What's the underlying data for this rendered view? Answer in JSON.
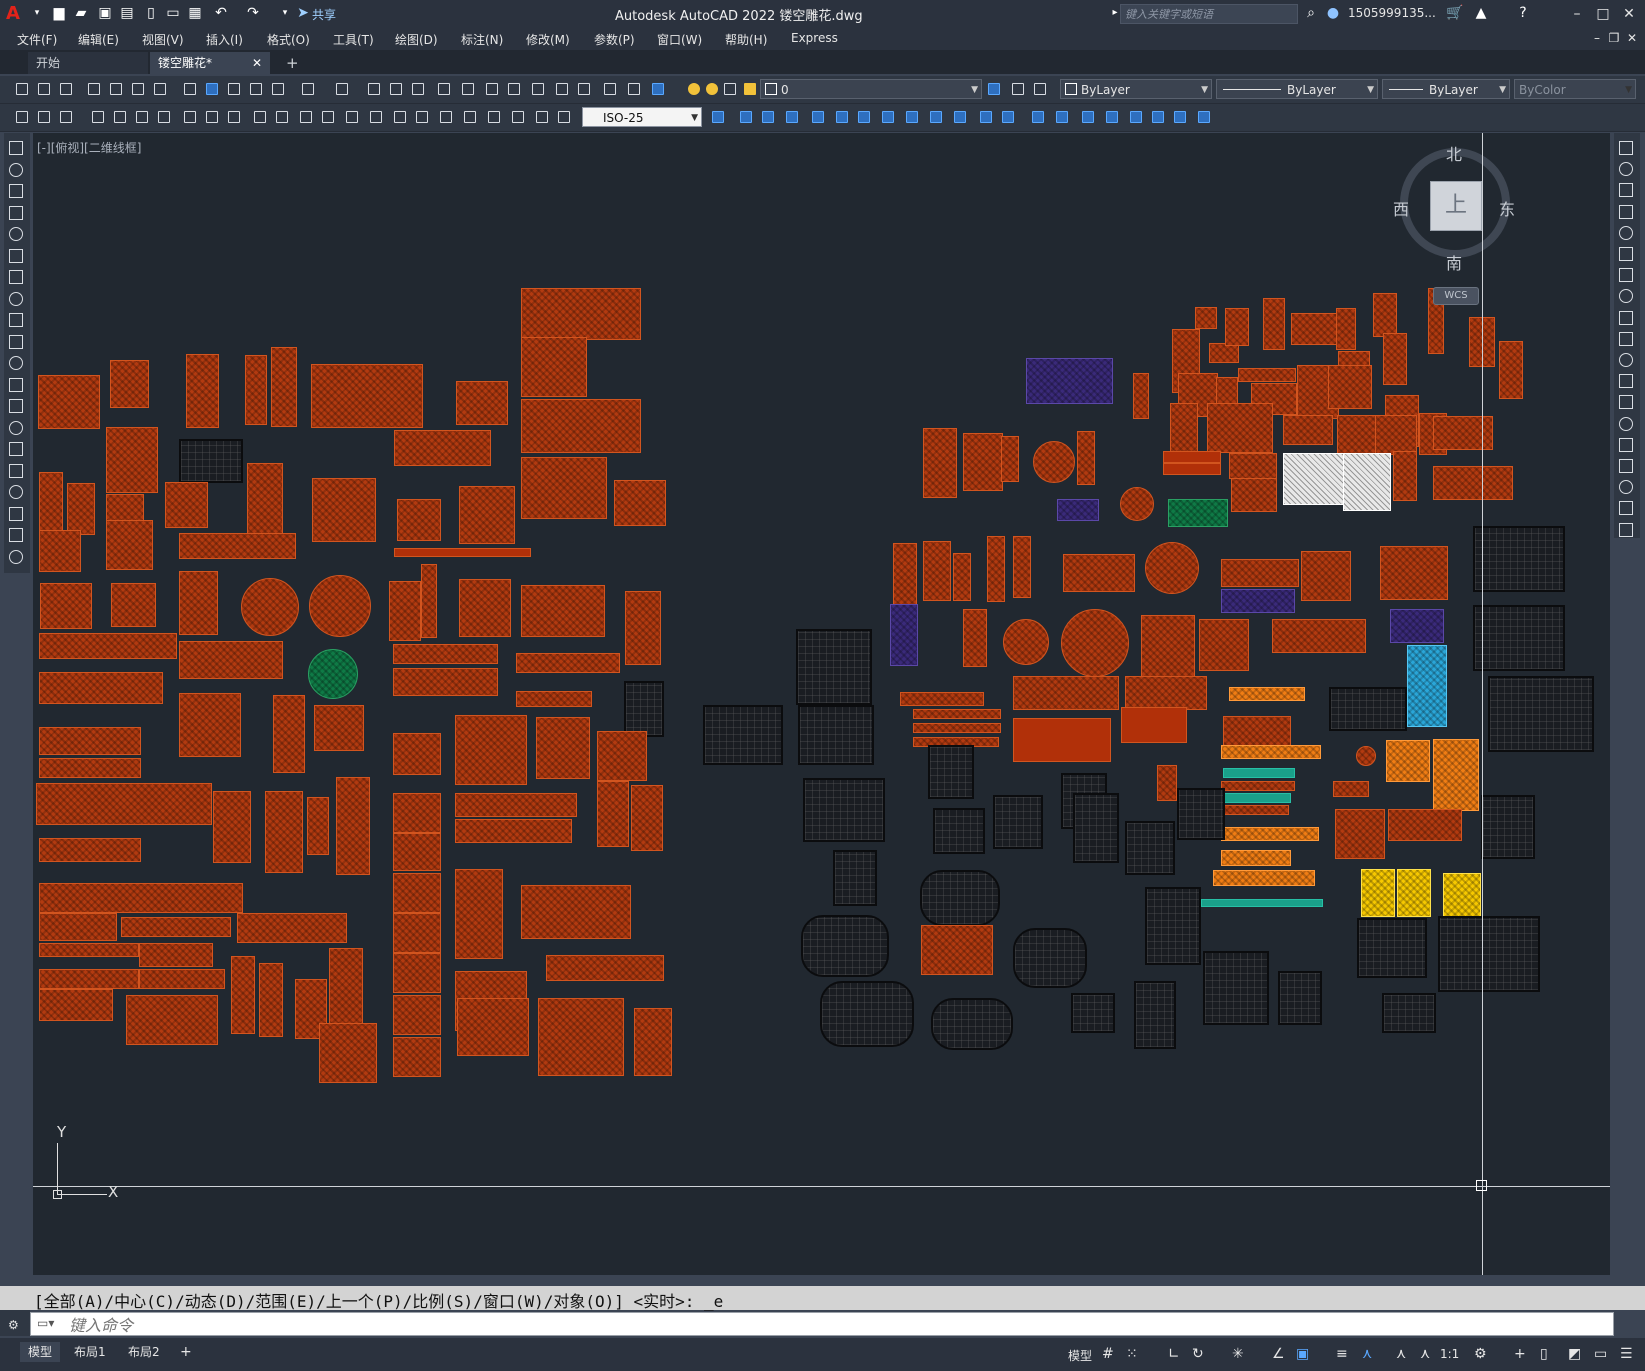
{
  "app": {
    "title": "Autodesk AutoCAD 2022    镂空雕花.dwg",
    "logo": "A",
    "share_label": "共享",
    "search_placeholder": "键入关键字或短语",
    "user": "1505999135...",
    "icons": [
      "new-icon",
      "open-icon",
      "save-icon",
      "saveas-icon",
      "plot-icon",
      "undo-icon",
      "redo-icon",
      "share-icon",
      "search-icon",
      "user-icon",
      "cart-icon",
      "help-icon"
    ]
  },
  "menu": {
    "items": [
      "文件(F)",
      "编辑(E)",
      "视图(V)",
      "插入(I)",
      "格式(O)",
      "工具(T)",
      "绘图(D)",
      "标注(N)",
      "修改(M)",
      "参数(P)",
      "窗口(W)",
      "帮助(H)",
      "Express"
    ]
  },
  "tabs": {
    "start": "开始",
    "active": "镂空雕花*",
    "add": "+"
  },
  "toolbar": {
    "layer": "0",
    "color": "ByLayer",
    "linetype": "ByLayer",
    "lineweight": "ByLayer",
    "plotstyle": "ByColor",
    "dimstyle": "ISO-25"
  },
  "viewport": {
    "label": "[-][俯视][二维线框]",
    "compass": {
      "north": "北",
      "south": "南",
      "east": "东",
      "west": "西",
      "top": "上"
    },
    "wcs": "WCS",
    "ucs_x": "X",
    "ucs_y": "Y"
  },
  "command": {
    "history": "[全部(A)/中心(C)/动态(D)/范围(E)/上一个(P)/比例(S)/窗口(W)/对象(O)] <实时>: _e",
    "placeholder": "键入命令"
  },
  "status": {
    "layouts": [
      "模型",
      "布局1",
      "布局2"
    ],
    "add": "+",
    "model": "模型",
    "scale": "1:1"
  },
  "colors": {
    "canvas": "#212830",
    "carving": "#b23a10",
    "ui_dark": "#2b323e"
  }
}
